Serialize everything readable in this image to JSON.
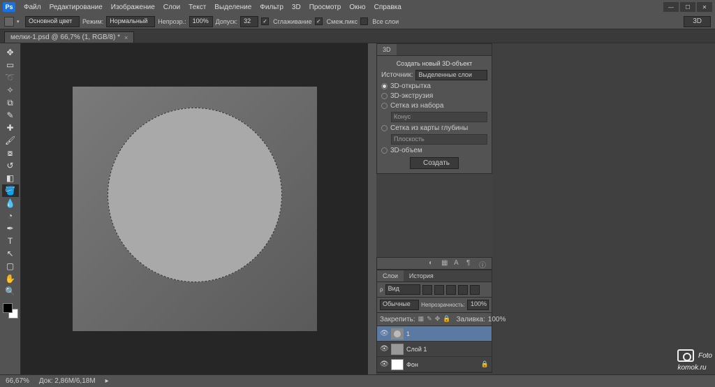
{
  "app": {
    "logo": "Ps"
  },
  "menu": [
    "Файл",
    "Редактирование",
    "Изображение",
    "Слои",
    "Текст",
    "Выделение",
    "Фильтр",
    "3D",
    "Просмотр",
    "Окно",
    "Справка"
  ],
  "optionsbar": {
    "foreground_label": "Основной цвет",
    "mode_label": "Режим:",
    "mode_value": "Нормальный",
    "opacity_label": "Непрозр.:",
    "opacity_value": "100%",
    "tolerance_label": "Допуск:",
    "tolerance_value": "32",
    "antialias_label": "Сглаживание",
    "contiguous_label": "Смеж.пикс",
    "all_layers_label": "Все слои",
    "threeD_label": "3D"
  },
  "doctab": {
    "title": "мелки-1.psd @ 66,7% (1, RGB/8) *"
  },
  "panel3d": {
    "tab": "3D",
    "title": "Создать новый 3D-объект",
    "source_label": "Источник:",
    "source_value": "Выделенные слои",
    "opt_postcard": "3D-открытка",
    "opt_extrusion": "3D-экструзия",
    "opt_mesh": "Сетка из набора",
    "mesh_preset": "Конус",
    "opt_depth": "Сетка из карты глубины",
    "depth_preset": "Плоскость",
    "opt_volume": "3D-объем",
    "create_btn": "Создать"
  },
  "layers_panel": {
    "tab_layers": "Слои",
    "tab_history": "История",
    "kind_label": "Вид",
    "blend_mode": "Обычные",
    "opacity_label": "Непрозрачность:",
    "opacity_value": "100%",
    "lock_label": "Закрепить:",
    "fill_label": "Заливка:",
    "fill_value": "100%",
    "layers": [
      {
        "name": "1",
        "selected": true,
        "thumb": "circle"
      },
      {
        "name": "Слой 1",
        "selected": false,
        "thumb": "grey"
      },
      {
        "name": "Фон",
        "selected": false,
        "thumb": "white",
        "locked": true
      }
    ]
  },
  "statusbar": {
    "zoom": "66,67%",
    "doc_info": "Док: 2,86M/6,18M"
  },
  "watermark": {
    "line1": "Foto",
    "line2": "komok.ru"
  }
}
